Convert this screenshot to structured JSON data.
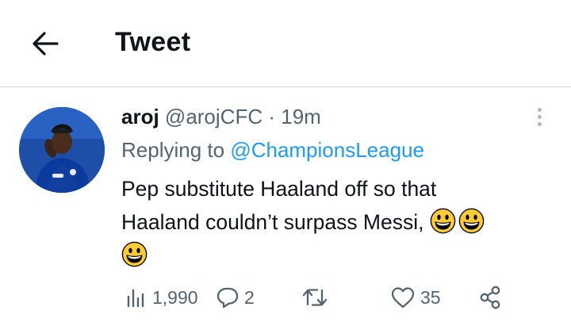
{
  "header": {
    "title": "Tweet"
  },
  "tweet": {
    "display_name": "aroj",
    "handle": "@arojCFC",
    "separator": "·",
    "time": "19m",
    "replying_prefix": "Replying to",
    "replying_to": "@ChampionsLeague",
    "text_line1": "Pep substitute Haaland off so that",
    "text_line2": "Haaland couldn’t surpass Messi,",
    "emojis": [
      "grinning-face",
      "grinning-face",
      "grinning-face"
    ],
    "actions": {
      "views": "1,990",
      "replies": "2",
      "retweets": "",
      "likes": "35"
    }
  },
  "colors": {
    "text": "#0f1419",
    "secondary": "#536471",
    "link": "#1d9bf0",
    "divider": "#d5dadd",
    "avatar_bg": "#1d4fa8",
    "emoji": "#ffcc33"
  }
}
